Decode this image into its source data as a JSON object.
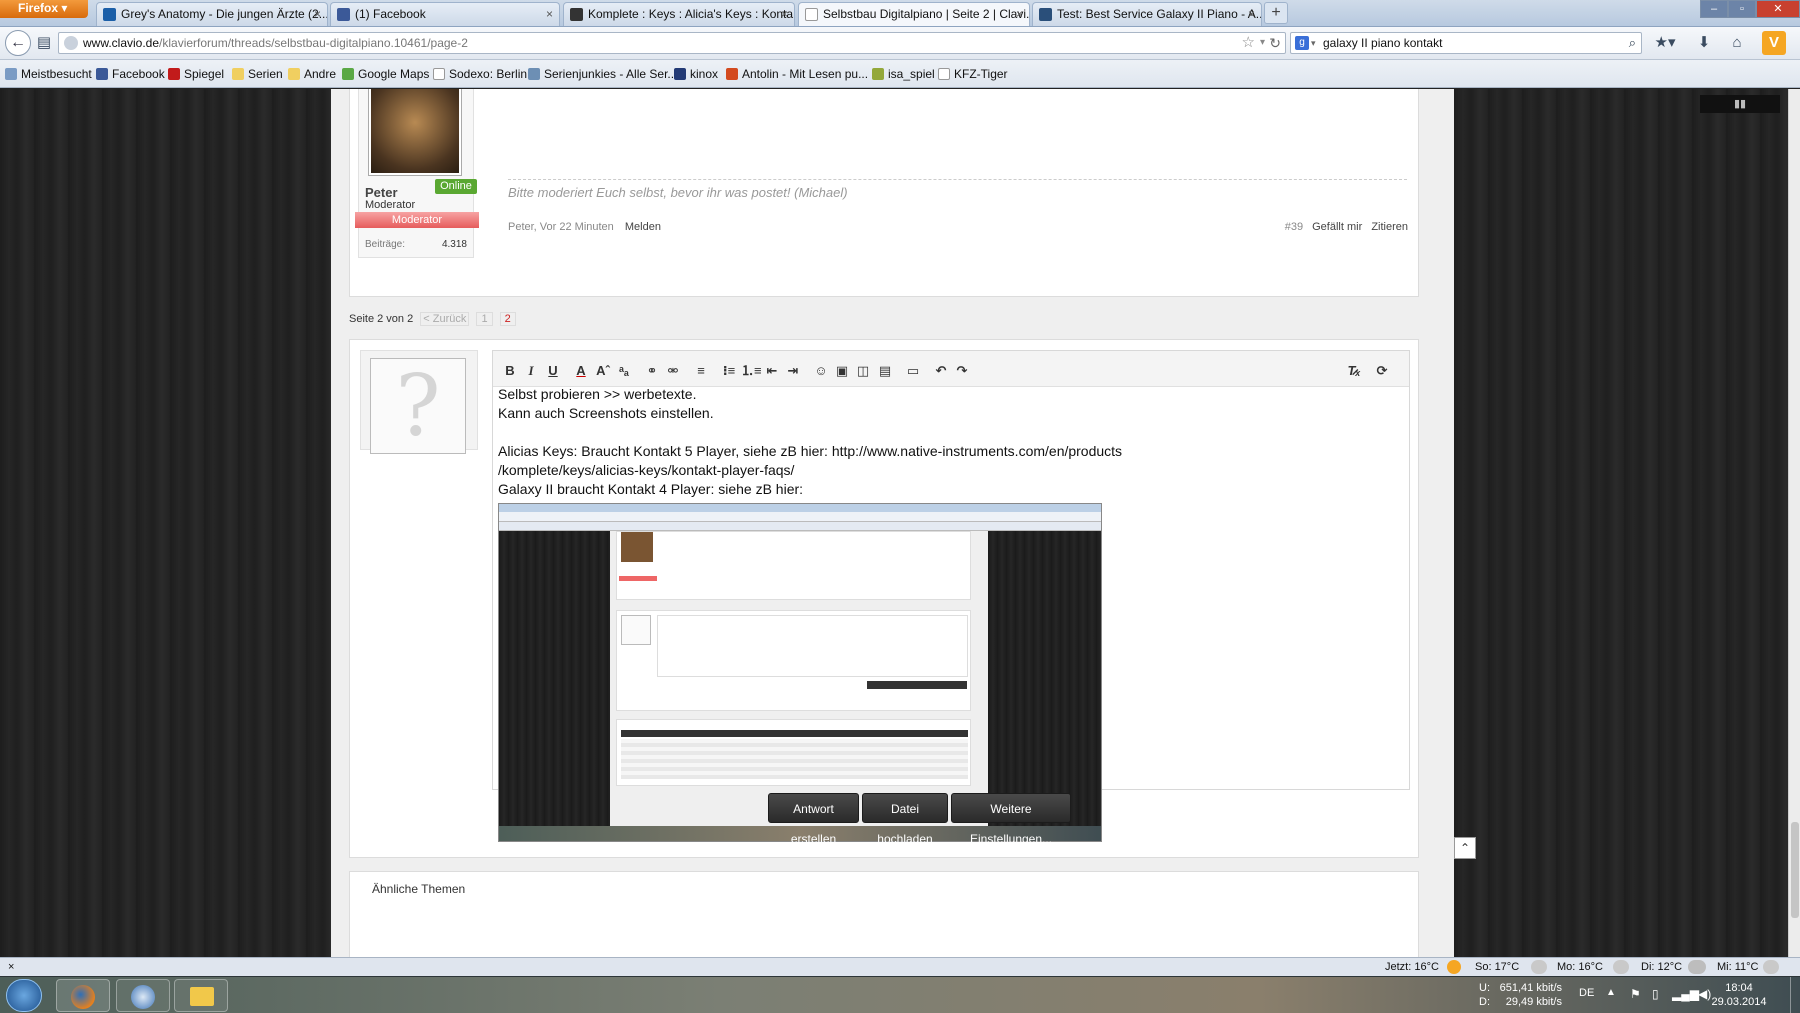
{
  "browser": {
    "menu_button": "Firefox",
    "tabs": [
      {
        "label": "Grey's Anatomy - Die jungen Ärzte (2...",
        "icon": "film-icon"
      },
      {
        "label": "(1) Facebook",
        "icon": "facebook-icon"
      },
      {
        "label": "Komplete : Keys : Alicia's Keys : Konta...",
        "icon": "ni-icon"
      },
      {
        "label": "Selbstbau Digitalpiano | Seite 2 | Clavi...",
        "icon": "page-icon"
      },
      {
        "label": "Test: Best Service Galaxy II Piano - A...",
        "icon": "page-icon"
      }
    ],
    "new_tab": "+",
    "url_domain": "www.clavio.de",
    "url_path": "/klavierforum/threads/selbstbau-digitalpiano.10461/page-2",
    "search_query": "galaxy II piano kontakt",
    "bookmarks": [
      {
        "label": "Meistbesucht",
        "icon": "star-icon"
      },
      {
        "label": "Facebook",
        "icon": "facebook-icon"
      },
      {
        "label": "Spiegel",
        "icon": "spiegel-icon"
      },
      {
        "label": "Serien",
        "icon": "folder-icon"
      },
      {
        "label": "Andre",
        "icon": "folder-icon"
      },
      {
        "label": "Google Maps",
        "icon": "map-icon"
      },
      {
        "label": "Sodexo: Berlin",
        "icon": "page-icon"
      },
      {
        "label": "Serienjunkies - Alle Ser...",
        "icon": "tv-icon"
      },
      {
        "label": "kinox",
        "icon": "kinox-icon"
      },
      {
        "label": "Antolin - Mit Lesen pu...",
        "icon": "antolin-icon"
      },
      {
        "label": "isa_spiel",
        "icon": "game-icon"
      },
      {
        "label": "KFZ-Tiger",
        "icon": "page-icon"
      }
    ]
  },
  "post": {
    "username": "Peter",
    "user_title": "Moderator",
    "online_badge": "Online",
    "role_banner": "Moderator",
    "posts_label": "Beiträge:",
    "posts_count": "4.318",
    "signature": "Bitte moderiert Euch selbst, bevor ihr was postet! (Michael)",
    "meta_author": "Peter, Vor 22 Minuten",
    "report_link": "Melden",
    "post_number": "#39",
    "like_link": "Gefällt mir",
    "quote_link": "Zitieren"
  },
  "pagination": {
    "label": "Seite 2 von 2",
    "prev": "< Zurück",
    "pages": [
      "1",
      "2"
    ]
  },
  "editor": {
    "lines": [
      "Selbst probieren >> werbetexte.",
      "Kann auch Screenshots einstellen.",
      "",
      "Alicias Keys: Braucht Kontakt 5 Player, siehe zB hier: http://www.native-instruments.com/en/products",
      "/komplete/keys/alicias-keys/kontakt-player-faqs/",
      "Galaxy II braucht Kontakt 4 Player: siehe zB hier:"
    ],
    "toolbar": [
      "B",
      "I",
      "U"
    ],
    "buttons": {
      "reply": "Antwort erstellen",
      "upload": "Datei hochladen",
      "more": "Weitere Einstellungen..."
    }
  },
  "similar_threads": {
    "title": "Ähnliche Themen"
  },
  "statusbar": {
    "close": "×",
    "weather": [
      {
        "label": "Jetzt: 16°C"
      },
      {
        "label": "So: 17°C"
      },
      {
        "label": "Mo: 16°C"
      },
      {
        "label": "Di: 12°C"
      },
      {
        "label": "Mi: 11°C"
      }
    ]
  },
  "taskbar": {
    "net_up_label": "U:",
    "net_down_label": "D:",
    "net_up": "651,41 kbit/s",
    "net_down": "29,49 kbit/s",
    "lang": "DE",
    "time": "18:04",
    "date": "29.03.2014"
  },
  "colors": {
    "accent_red": "#cc2222",
    "online_green": "#5aa832",
    "moderator_banner": "#f06e6e",
    "firefox_orange": "#e4801f"
  }
}
